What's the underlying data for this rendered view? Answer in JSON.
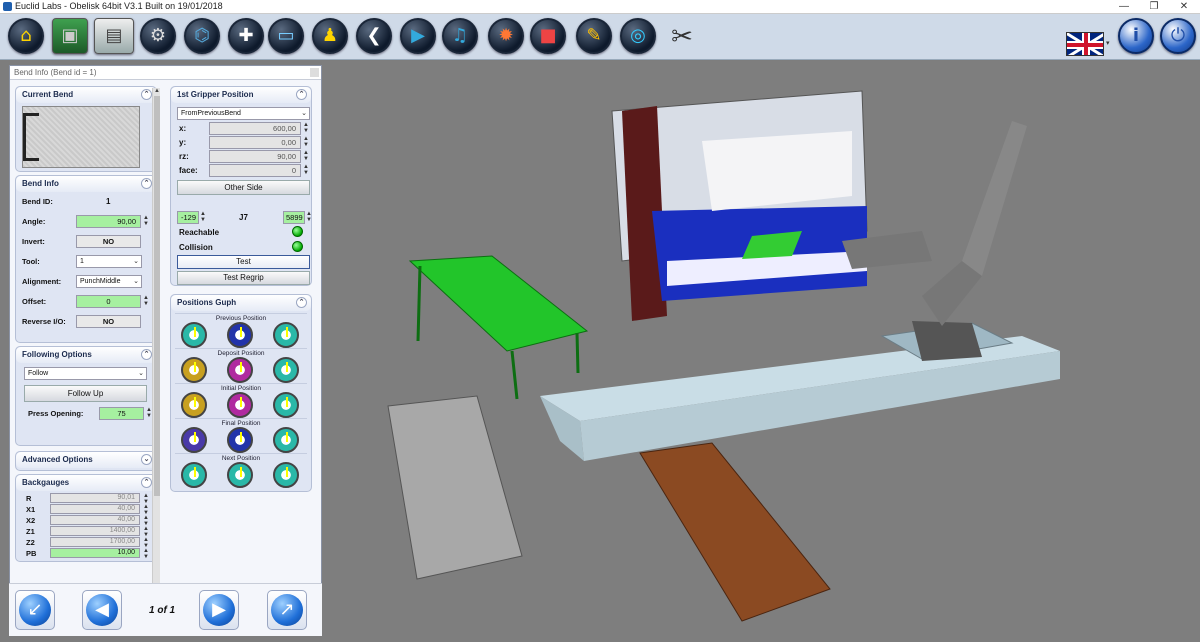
{
  "window": {
    "title": "Euclid Labs - Obelisk 64bit V3.1 Built on 19/01/2018",
    "minimize": "—",
    "maximize": "❐",
    "close": "✕"
  },
  "toolbar": {
    "left_icons": [
      "home-icon",
      "folders-icon",
      "scanner-icon",
      "gear-part-icon",
      "robot-cell-icon",
      "gamepad-icon",
      "press-brake-icon",
      "walker-icon",
      "bend-arrow-icon",
      "play-icon",
      "music-icon",
      "fire-icon",
      "box-icon",
      "wrench-icon",
      "radar-icon",
      "tools-icon"
    ],
    "right_icons": [
      "uk-flag-icon",
      "info-icon",
      "plug-icon"
    ]
  },
  "panel": {
    "title": "Bend Info (Bend id = 1)",
    "current_bend": {
      "header": "Current Bend"
    },
    "bend_info": {
      "header": "Bend Info",
      "bend_id_label": "Bend ID:",
      "bend_id": "1",
      "angle_label": "Angle:",
      "angle": "90,00",
      "invert_label": "Invert:",
      "invert": "NO",
      "tool_label": "Tool:",
      "tool": "1",
      "alignment_label": "Alignment:",
      "alignment": "PunchMiddle",
      "offset_label": "Offset:",
      "offset": "0",
      "reverse_label": "Reverse I/O:",
      "reverse": "NO"
    },
    "following": {
      "header": "Following Options",
      "mode": "Follow",
      "follow_up": "Follow Up",
      "press_opening_label": "Press Opening:",
      "press_opening": "75"
    },
    "advanced": {
      "header": "Advanced Options"
    },
    "backgauges": {
      "header": "Backgauges",
      "rows": [
        {
          "label": "R",
          "value": "90,01"
        },
        {
          "label": "X1",
          "value": "40,00"
        },
        {
          "label": "X2",
          "value": "40,00"
        },
        {
          "label": "Z1",
          "value": "1400,00"
        },
        {
          "label": "Z2",
          "value": "1700,00"
        },
        {
          "label": "PB",
          "value": "10,00"
        }
      ]
    },
    "gripper": {
      "header": "1st Gripper Position",
      "mode": "FromPreviousBend",
      "x_label": "x:",
      "x": "600,00",
      "y_label": "y:",
      "y": "0,00",
      "rz_label": "rz:",
      "rz": "90,00",
      "face_label": "face:",
      "face": "0",
      "other_side": "Other Side",
      "j_left": "-129",
      "j_label": "J7",
      "j_right": "5899",
      "reachable": "Reachable",
      "collision": "Collision",
      "test": "Test",
      "test_regrip": "Test Regrip"
    },
    "positions_graph": {
      "header": "Positions Guph",
      "rows": [
        {
          "title": "Previous Position",
          "colors": [
            "#2ab8a8",
            "#2233aa",
            "#2ab8a8"
          ]
        },
        {
          "title": "Deposit Position",
          "colors": [
            "#c8a020",
            "#b02aa0",
            "#2ab8a8"
          ]
        },
        {
          "title": "Initial Position",
          "colors": [
            "#c8a020",
            "#b02aa0",
            "#2ab8a8"
          ]
        },
        {
          "title": "Final Position",
          "colors": [
            "#4a3aa8",
            "#2233aa",
            "#2ab8a8"
          ]
        },
        {
          "title": "Next Position",
          "colors": [
            "#2ab8a8",
            "#2ab8a8",
            "#2ab8a8"
          ]
        }
      ]
    }
  },
  "footer": {
    "page_indicator": "1 of 1"
  }
}
